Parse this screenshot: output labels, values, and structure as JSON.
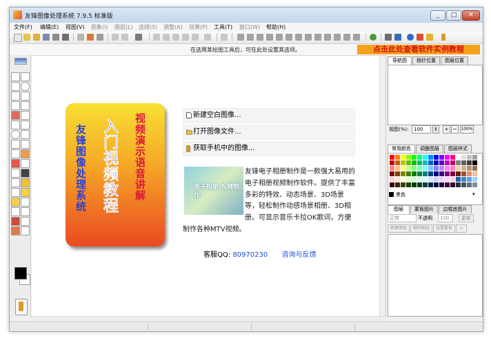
{
  "window": {
    "title": "友锋图像处理系统 7.9.5 标准版"
  },
  "menu": [
    {
      "label": "文件(F)",
      "enabled": true
    },
    {
      "label": "编辑(E)",
      "enabled": true
    },
    {
      "label": "视图(V)",
      "enabled": true
    },
    {
      "label": "图象(I)",
      "enabled": false
    },
    {
      "label": "图层(L)",
      "enabled": false
    },
    {
      "label": "选择(S)",
      "enabled": false
    },
    {
      "label": "调整(A)",
      "enabled": false
    },
    {
      "label": "效果(P)",
      "enabled": false
    },
    {
      "label": "工具(T)",
      "enabled": true
    },
    {
      "label": "窗口(W)",
      "enabled": false
    },
    {
      "label": "帮助(H)",
      "enabled": true
    }
  ],
  "hintbar": {
    "hint": "在选用某绘图工具后，可在此处设置其选项。",
    "promo": "点击此处查看软件实例教程"
  },
  "panel": {
    "nav_tabs": [
      "导航图",
      "指针位置",
      "图层位置"
    ],
    "zoom_label": "视图(%):",
    "zoom_value": "100",
    "zoom_fit": "100%",
    "zoom_plus": "+",
    "zoom_minus": "−",
    "color_tabs": [
      "常用颜色",
      "调整图层",
      "图层样式"
    ],
    "current_color": "黑色",
    "layer_tabs": [
      "图层",
      "蒙板图片",
      "边框底图片"
    ],
    "blend_mode": "正常",
    "opacity_label": "不透明",
    "opacity_value": "100",
    "layer_buttons": [
      "新建图层",
      "删除图层",
      "设置蒙板"
    ],
    "clear_btn": "更新"
  },
  "welcome": {
    "cover": {
      "main_title": "入门视频教程",
      "left_text": "友锋图像处理系统",
      "right_text": "视频演示语音讲解"
    },
    "actions": [
      {
        "label": "新建空白图像...",
        "icon": "new-file-icon"
      },
      {
        "label": "打开图像文件...",
        "icon": "open-folder-icon"
      },
      {
        "label": "获取手机中的图像...",
        "icon": "phone-icon"
      }
    ],
    "promo_thumb_text": "电子相册 视频制作",
    "description": "友锋电子相册制作是一款强大易用的电子相册视频制作软件。提供了丰富多彩的特效、动态场景、3D场景等，轻松制作动感场景相册、3D相册。可显示音乐卡拉OK歌词，方便制作各种MTV视频。",
    "contact_label": "客服QQ:",
    "contact_qq": "80970230",
    "feedback_link": "咨询与反馈"
  },
  "colors": {
    "window_bg": "#f0f0f0",
    "promo_bg": "#f4a21c",
    "promo_text": "#d51111",
    "link": "#1f4fd3"
  }
}
